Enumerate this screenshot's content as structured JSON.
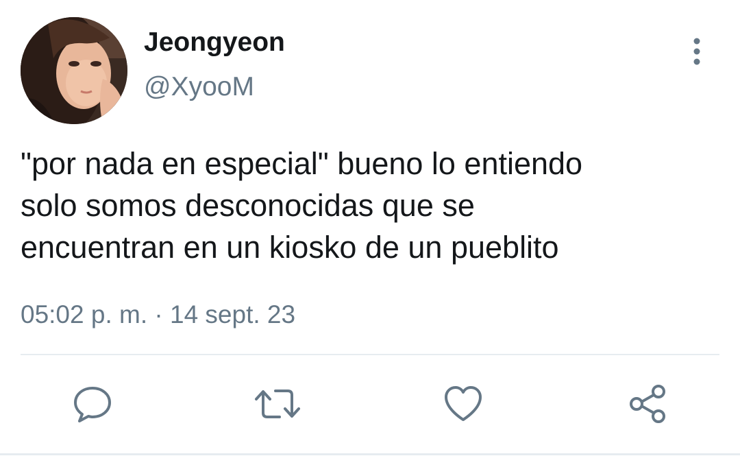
{
  "author": {
    "display_name": "Jeongyeon",
    "handle": "@XyooM",
    "avatar_icon": "profile-photo"
  },
  "tweet": {
    "text_lines": [
      "\"por nada en especial\" bueno lo entiendo",
      "solo somos desconocidas que se",
      "encuentran en un kiosko de un pueblito"
    ],
    "time": "05:02 p. m.",
    "separator": "·",
    "date": "14 sept. 23"
  },
  "actions": {
    "icons": [
      "reply-icon",
      "retweet-icon",
      "like-icon",
      "share-icon"
    ],
    "more_icon": "more-vertical-icon"
  },
  "colors": {
    "text": "#14171a",
    "secondary": "#657786",
    "divider": "#e6ecf0"
  }
}
